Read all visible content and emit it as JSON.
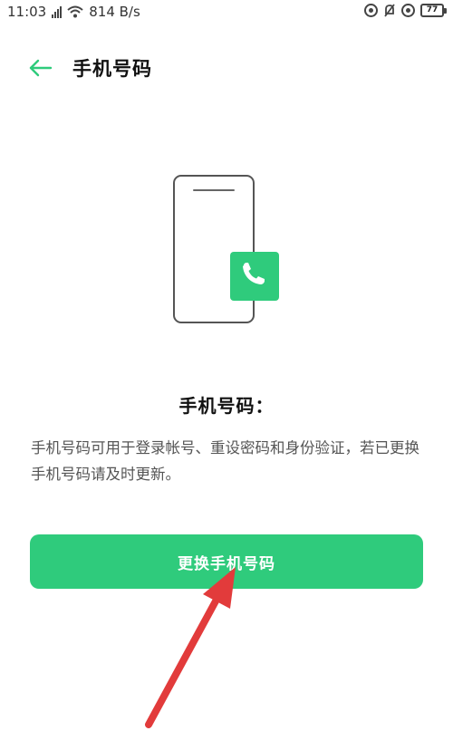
{
  "status_bar": {
    "time": "11:03",
    "network_speed": "814 B/s",
    "battery_level": "77"
  },
  "header": {
    "title": "手机号码",
    "back_icon": "arrow-left-icon"
  },
  "illustration": {
    "icons": [
      "phone-outline-icon",
      "phone-call-icon"
    ]
  },
  "content": {
    "heading": "手机号码：",
    "description": "手机号码可用于登录帐号、重设密码和身份验证，若已更换手机号码请及时更新。"
  },
  "actions": {
    "change_button_label": "更换手机号码"
  },
  "colors": {
    "accent_green": "#2fcb7c",
    "annotation_red": "#e23b3b"
  }
}
